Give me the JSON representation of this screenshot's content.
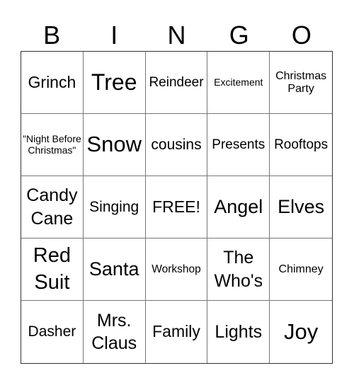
{
  "header": {
    "letters": [
      "B",
      "I",
      "N",
      "G",
      "O"
    ]
  },
  "card": {
    "rows": [
      [
        "Grinch",
        "Tree",
        "Reindeer",
        "Excitement",
        "Christmas Party"
      ],
      [
        "\"Night Before Christmas\"",
        "Snow",
        "cousins",
        "Presents",
        "Rooftops"
      ],
      [
        "Candy Cane",
        "Singing",
        "FREE!",
        "Angel",
        "Elves"
      ],
      [
        "Red Suit",
        "Santa",
        "Workshop",
        "The Who's",
        "Chimney"
      ],
      [
        "Dasher",
        "Mrs. Claus",
        "Family",
        "Lights",
        "Joy"
      ]
    ]
  }
}
